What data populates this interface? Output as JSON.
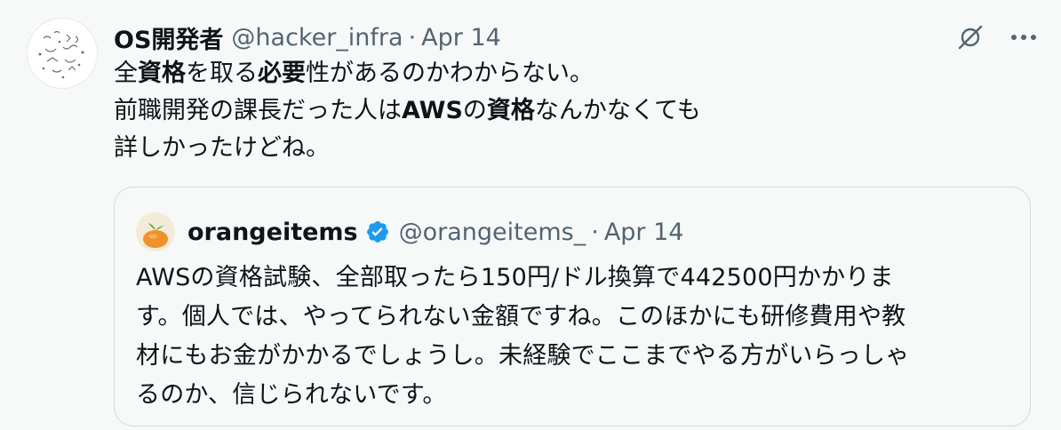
{
  "tweet": {
    "author_name": "OS開発者",
    "handle": "@hacker_infra",
    "separator": "·",
    "date": "Apr 14",
    "text_segments": [
      {
        "text": "全",
        "bold": false
      },
      {
        "text": "資格",
        "bold": true
      },
      {
        "text": "を取る",
        "bold": false
      },
      {
        "text": "必要",
        "bold": true
      },
      {
        "text": "性があるのかわからない。\n前職開発の課長だった人は",
        "bold": false
      },
      {
        "text": "AWS",
        "bold": true
      },
      {
        "text": "の",
        "bold": false
      },
      {
        "text": "資格",
        "bold": true
      },
      {
        "text": "なんかなくても\n詳しかったけどね。",
        "bold": false
      }
    ],
    "actions": {
      "grok_icon": "grok-icon",
      "more_icon": "more-icon"
    }
  },
  "quote": {
    "author_name": "orangeitems",
    "verified": true,
    "handle": "@orangeitems_",
    "separator": "·",
    "date": "Apr 14",
    "text": "AWSの資格試験、全部取ったら150円/ドル換算で442500円かかりま\nす。個人では、やってられない金額ですね。このほかにも研修費用や教\n材にもお金がかかるでしょうし。未経験でここまでやる方がいらっしゃ\nるのか、信じられないです。"
  },
  "colors": {
    "background": "#f7f9f9",
    "text": "#0f1419",
    "muted": "#536471",
    "border": "#cfd9de",
    "verified": "#1d9bf0"
  }
}
